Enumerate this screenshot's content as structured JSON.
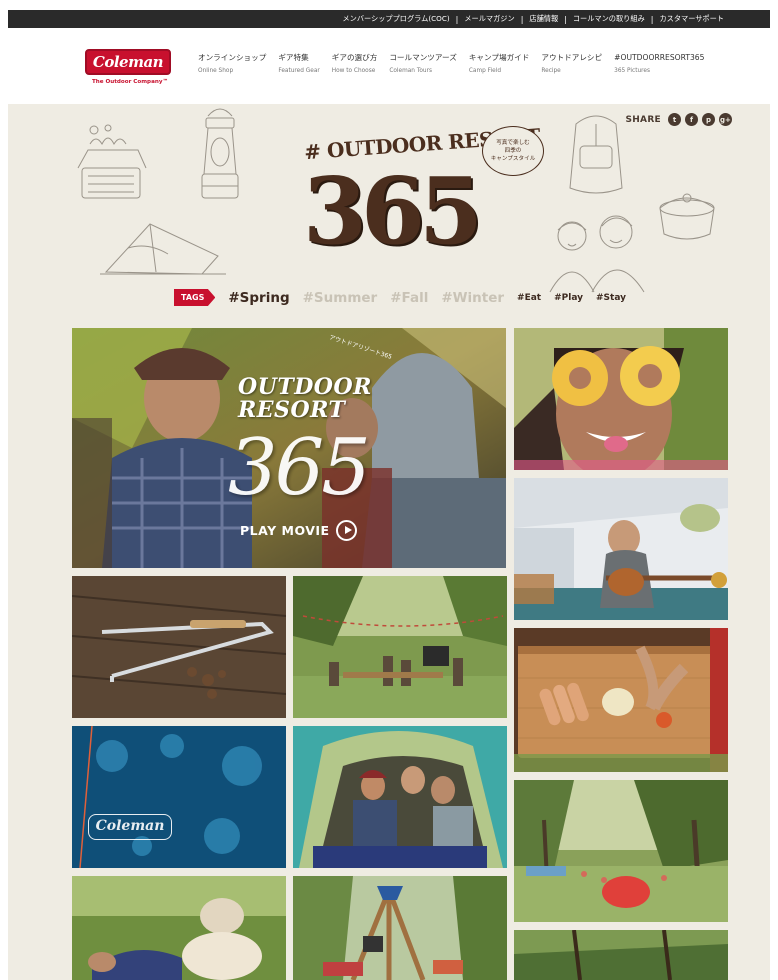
{
  "utility_nav": {
    "items": [
      "メンバーシッププログラム(COC)",
      "メールマガジン",
      "店舗情報",
      "コールマンの取り組み",
      "カスタマーサポート"
    ]
  },
  "brand": {
    "logo_text": "Coleman",
    "tagline": "The Outdoor Company™",
    "red": "#c8102e"
  },
  "global_nav": [
    {
      "jp": "オンラインショップ",
      "en": "Online Shop"
    },
    {
      "jp": "ギア特集",
      "en": "Featured Gear"
    },
    {
      "jp": "ギアの選び方",
      "en": "How to Choose"
    },
    {
      "jp": "コールマンツアーズ",
      "en": "Coleman Tours"
    },
    {
      "jp": "キャンプ場ガイド",
      "en": "Camp Field"
    },
    {
      "jp": "アウトドアレシピ",
      "en": "Recipe"
    },
    {
      "jp": "#OUTDOORRESORT365",
      "en": "365 Pictures"
    }
  ],
  "share": {
    "label": "SHARE",
    "icons": [
      "twitter-icon",
      "facebook-icon",
      "pinterest-icon",
      "google-plus-icon"
    ],
    "glyphs": [
      "t",
      "f",
      "p",
      "g+"
    ]
  },
  "hero": {
    "title": "# OUTDOOR RESORT",
    "number": "365",
    "bubble_lines": [
      "写真で楽しむ",
      "四季の",
      "キャンプスタイル"
    ]
  },
  "tags": {
    "label": "TAGS",
    "big": [
      {
        "text": "#Spring",
        "active": true
      },
      {
        "text": "#Summer",
        "active": false
      },
      {
        "text": "#Fall",
        "active": false
      },
      {
        "text": "#Winter",
        "active": false
      }
    ],
    "small": [
      "#Eat",
      "#Play",
      "#Stay"
    ]
  },
  "movie": {
    "title_line1": "OUTDOOR",
    "title_line2": "RESORT",
    "number": "365",
    "small_text": "アウトドアリゾート365",
    "play_label": "PLAY MOVIE"
  },
  "tile_logo": "Coleman",
  "colors": {
    "top_bar": "#2a2a2a",
    "background": "#efece3",
    "brown": "#4b2e1e",
    "dim_tag": "#c9c3b6"
  }
}
